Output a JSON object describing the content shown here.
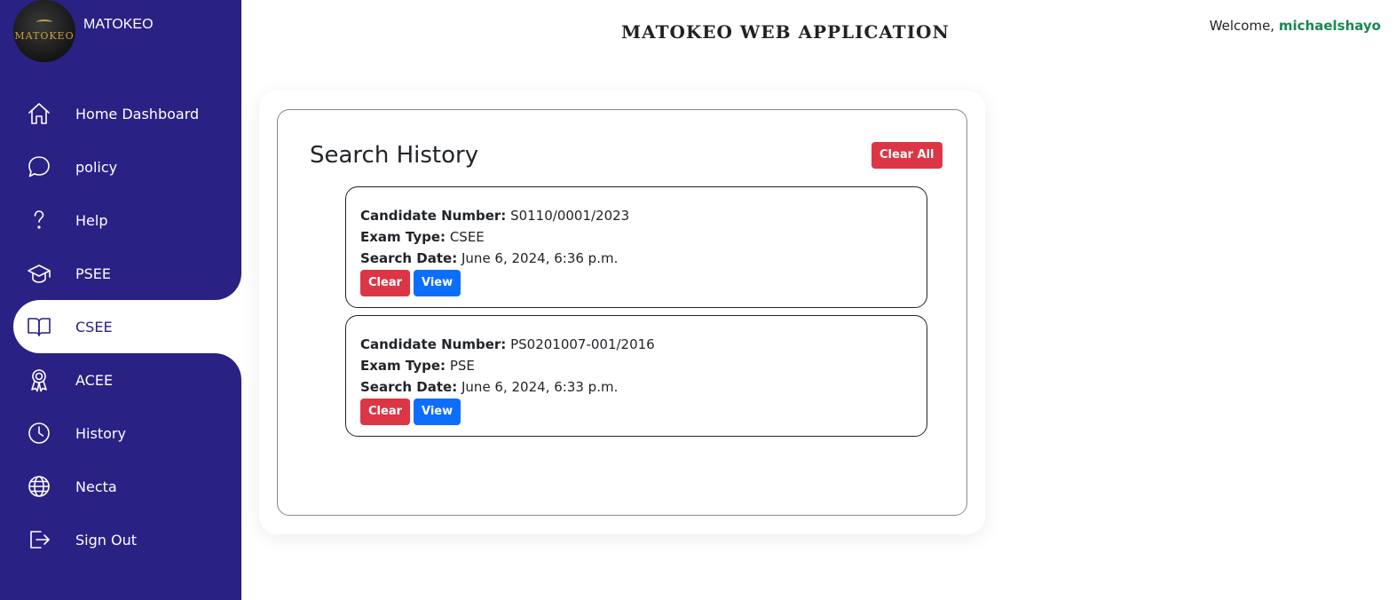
{
  "app": {
    "brand": "MATOKEO",
    "logo_text": "MATOKEO",
    "title": "MATOKEO WEB APPLICATION"
  },
  "header": {
    "welcome_prefix": "Welcome,",
    "username": "michaelshayo"
  },
  "sidebar": {
    "items": [
      {
        "label": "Home Dashboard",
        "icon": "home-icon"
      },
      {
        "label": "policy",
        "icon": "chat-bubble-icon"
      },
      {
        "label": "Help",
        "icon": "question-icon"
      },
      {
        "label": "PSEE",
        "icon": "graduation-cap-icon"
      },
      {
        "label": "CSEE",
        "icon": "book-open-icon",
        "active": true
      },
      {
        "label": "ACEE",
        "icon": "award-ribbon-icon"
      },
      {
        "label": "History",
        "icon": "clock-icon"
      },
      {
        "label": "Necta",
        "icon": "globe-icon"
      },
      {
        "label": "Sign Out",
        "icon": "sign-out-icon"
      }
    ]
  },
  "history": {
    "title": "Search History",
    "clear_all_label": "Clear All",
    "candidate_label": "Candidate Number:",
    "exam_label": "Exam Type:",
    "date_label": "Search Date:",
    "clear_label": "Clear",
    "view_label": "View",
    "entries": [
      {
        "candidate_number": "S0110/0001/2023",
        "exam_type": "CSEE",
        "search_date": "June 6, 2024, 6:36 p.m."
      },
      {
        "candidate_number": "PS0201007-001/2016",
        "exam_type": "PSE",
        "search_date": "June 6, 2024, 6:33 p.m."
      }
    ]
  },
  "colors": {
    "sidebar": "#2a2185",
    "danger": "#dc3545",
    "primary": "#0d6efd",
    "username": "#198754"
  }
}
